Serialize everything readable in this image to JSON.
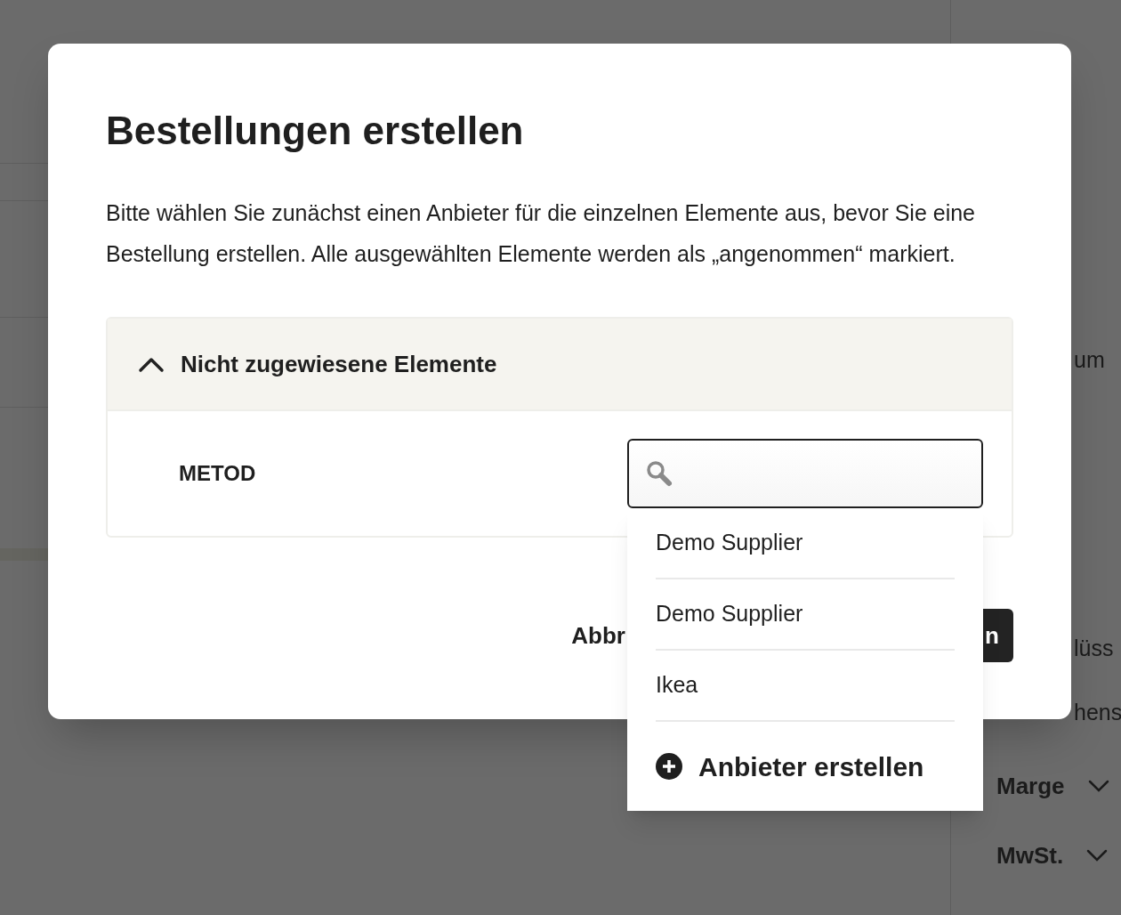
{
  "background": {
    "items": [
      {
        "kind": "label",
        "text": "um"
      },
      {
        "kind": "label",
        "text": "lüss"
      },
      {
        "kind": "label",
        "text": "hens"
      },
      {
        "kind": "dropdown",
        "text": "Marge"
      },
      {
        "kind": "dropdown",
        "text": "MwSt."
      }
    ]
  },
  "dialog": {
    "title": "Bestellungen erstellen",
    "description": "Bitte wählen Sie zunächst einen Anbieter für die einzelnen Elemente aus, bevor Sie eine Bestellung erstellen. Alle ausgewählten Elemente werden als „angenommen“ markiert.",
    "section": {
      "title": "Nicht zugewiesene Elemente",
      "expanded": true,
      "rows": [
        {
          "name": "METOD",
          "menu_open": true
        }
      ]
    },
    "menu": {
      "options": [
        "Demo Supplier",
        "Demo Supplier",
        "Ikea"
      ],
      "create_label": "Anbieter erstellen"
    },
    "buttons": [
      {
        "kind": "secondary",
        "label": "Abbr"
      },
      {
        "kind": "primary",
        "label": "n"
      }
    ]
  }
}
